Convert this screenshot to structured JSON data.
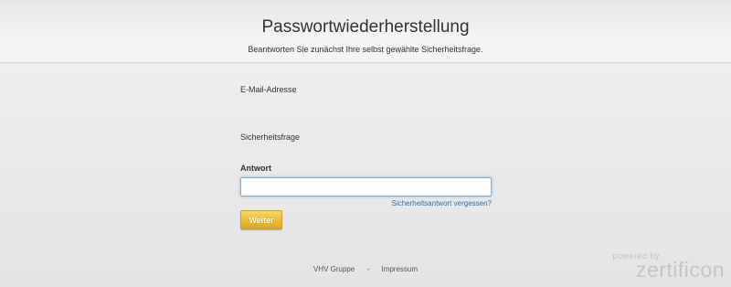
{
  "header": {
    "title": "Passwortwiederherstellung",
    "subtitle": "Beantworten Sie zunächst Ihre selbst gewählte Sicherheitsfrage."
  },
  "form": {
    "email_label": "E-Mail-Adresse",
    "question_label": "Sicherheitsfrage",
    "answer_label": "Antwort",
    "answer_value": "",
    "forgot_link": "Sicherheitsantwort vergessen?",
    "submit_label": "Weiter"
  },
  "footer": {
    "group_link": "VHV Gruppe",
    "separator": "-",
    "imprint_link": "Impressum"
  },
  "brand": {
    "powered_by": "powered by",
    "logo_text": "zertificon"
  },
  "colors": {
    "button": "#e7bd3a",
    "link": "#2f6ea8",
    "input_focus": "#7fb0dc"
  }
}
